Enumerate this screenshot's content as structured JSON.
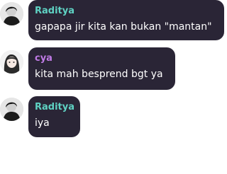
{
  "messages": [
    {
      "sender": "Raditya",
      "sender_color": "#5fd2c3",
      "avatar_icon": "bw-portrait-avatar",
      "text": "gapapa jir kita kan bukan \"mantan\""
    },
    {
      "sender": "cya",
      "sender_color": "#c07be6",
      "avatar_icon": "anime-girl-avatar",
      "text": "kita mah besprend bgt ya"
    },
    {
      "sender": "Raditya",
      "sender_color": "#5fd2c3",
      "avatar_icon": "bw-portrait-avatar",
      "text": "iya"
    }
  ]
}
